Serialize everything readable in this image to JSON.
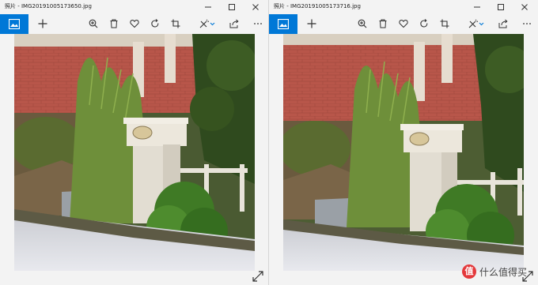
{
  "windows": [
    {
      "app_name": "照片",
      "separator": " - ",
      "filename": "IMG20191005173650.jpg"
    },
    {
      "app_name": "照片",
      "separator": " - ",
      "filename": "IMG20191005173716.jpg"
    }
  ],
  "toolbar_icons": [
    "image-icon",
    "plus-icon",
    "zoom-icon",
    "trash-icon",
    "heart-icon",
    "rotate-icon",
    "crop-icon",
    "edit-icon",
    "share-icon",
    "more-icon"
  ],
  "colors": {
    "accent": "#0078d7",
    "titlebar": "#f3f3f3"
  },
  "watermark": {
    "text": "什么值得买",
    "logo_char": "值"
  }
}
